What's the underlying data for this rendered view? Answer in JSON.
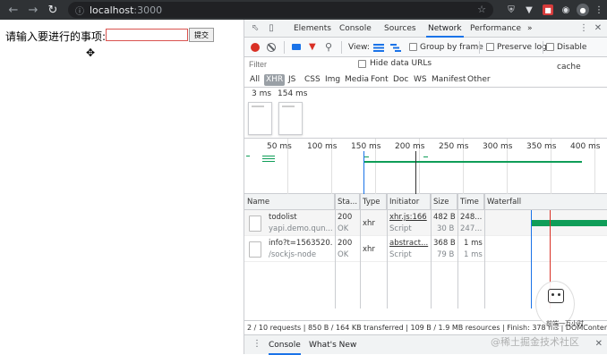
{
  "browser": {
    "url_host": "localhost",
    "url_port": ":3000"
  },
  "page": {
    "todo_label": "请输入要进行的事项:",
    "todo_input_value": "",
    "submit_label": "提交"
  },
  "devtools": {
    "tabs": [
      "Elements",
      "Console",
      "Sources",
      "Network",
      "Performance"
    ],
    "active_tab": "Network",
    "more_tabs": "»",
    "toolbar": {
      "view_label": "View:",
      "group_by_frame": "Group by frame",
      "preserve_log": "Preserve log",
      "disable_cache": "Disable cache"
    },
    "filter": {
      "placeholder": "Filter",
      "hide_data_urls": "Hide data URLs"
    },
    "type_filters": [
      "All",
      "XHR",
      "JS",
      "CSS",
      "Img",
      "Media",
      "Font",
      "Doc",
      "WS",
      "Manifest",
      "Other"
    ],
    "active_type_filter": "XHR",
    "filmstrip": {
      "frames": [
        "3 ms",
        "154 ms"
      ]
    },
    "overview": {
      "ticks": [
        "50 ms",
        "100 ms",
        "150 ms",
        "200 ms",
        "250 ms",
        "300 ms",
        "350 ms",
        "400 ms"
      ]
    },
    "columns": [
      "Name",
      "Sta...",
      "Type",
      "Initiator",
      "Size",
      "Time",
      "Waterfall"
    ],
    "requests": [
      {
        "name": "todolist",
        "name_sub": "yapi.demo.qun...",
        "status": "200",
        "status_sub": "OK",
        "type": "xhr",
        "initiator": "xhr.js:166",
        "initiator_sub": "Script",
        "size": "482 B",
        "size_sub": "30 B",
        "time": "248...",
        "time_sub": "247..."
      },
      {
        "name": "info?t=1563520...",
        "name_sub": "/sockjs-node",
        "status": "200",
        "status_sub": "OK",
        "type": "xhr",
        "initiator": "abstract...",
        "initiator_sub": "Script",
        "size": "368 B",
        "size_sub": "79 B",
        "time": "1 ms",
        "time_sub": "1 ms"
      }
    ],
    "status_bar": "2 / 10 requests | 850 B / 164 KB transferred | 109 B / 1.9 MB resources | Finish: 378 ms | DOMContentL...",
    "drawer": {
      "tabs": [
        "Console",
        "What's New"
      ]
    }
  },
  "overlay": {
    "watermark": "@稀土掘金技术社区",
    "promo_text": "前端一万小时"
  },
  "colors": {
    "record": "#d93025",
    "accent": "#1a73e8",
    "waterfall_bar": "#0f9d58"
  }
}
